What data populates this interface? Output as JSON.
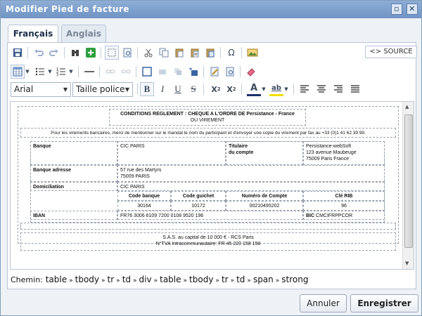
{
  "window": {
    "title": "Modifier Pied de facture"
  },
  "tabs": [
    {
      "label": "Français",
      "active": true
    },
    {
      "label": "Anglais",
      "active": false
    }
  ],
  "toolbar": {
    "source_label": "SOURCE",
    "source_icon": "code-icon",
    "font_select": "Arial",
    "size_select": "Taille police",
    "omega": "Ω",
    "bold": "B",
    "italic": "I",
    "underline": "U",
    "strike": "S",
    "subscript": "X",
    "subscript_mark": "2",
    "superscript": "X",
    "superscript_mark": "2",
    "font_color": "A",
    "bg_color": "ab"
  },
  "document": {
    "heading_line1": "CONDITIONS REGLEMENT : CHEQUE A L'ORDRE DE Persistance - France",
    "heading_line2": "OU VIREMENT",
    "intro": "Pour les virements bancaires, merci de mentionner sur le mandat le nom du participant et d'envoyer une copie du virement par fax au +33 (0)1 41 62 39 99.",
    "banque_label": "Banque",
    "banque_value": "CIC PARIS",
    "titulaire_label_1": "Titulaire",
    "titulaire_label_2": "du compte",
    "titulaire_value_1": "Persistance-webSoft",
    "titulaire_value_2": "123 avenue Maubeuge",
    "titulaire_value_3": "75009 Paris France",
    "banque_adresse_label": "Banque adresse",
    "banque_adresse_1": "57 rue des Martyrs",
    "banque_adresse_2": "75009 PARIS",
    "domiciliation_label": "Domiciliation",
    "domiciliation_value": "CIC PARIS",
    "col_code_banque": "Code banque",
    "col_code_guichet": "Code guichet",
    "col_numero_compte": "Numéro de Compte",
    "col_cle_rib": "Clé RIB",
    "val_code_banque": "30164",
    "val_code_guichet": "10172",
    "val_numero_compte": "00210495202",
    "val_cle_rib": "96",
    "iban_label": "IBAN",
    "iban_value": "FR76 3006 6109 7200 0108 9520 196",
    "bic_label": "BIC",
    "bic_value": "CMCIFRPPCOR",
    "footer_line1": "S.A.S. au capital de 10 000 € - RCS Paris",
    "footer_line2": "N°TVA Intracommunautaire: FR 45 220 158 158"
  },
  "path": {
    "label": "Chemin:",
    "items": [
      "table",
      "tbody",
      "tr",
      "td",
      "div",
      "table",
      "tbody",
      "tr",
      "td",
      "span",
      "strong"
    ],
    "separator": "»"
  },
  "buttons": {
    "cancel": "Annuler",
    "save": "Enregistrer"
  }
}
